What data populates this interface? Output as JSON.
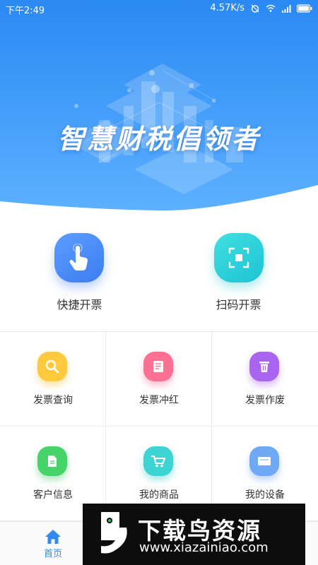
{
  "status_bar": {
    "time": "下午2:49",
    "speed": "4.57K/s",
    "icons": [
      "alarm-icon",
      "wifi-icon",
      "signal-icon",
      "battery-icon"
    ]
  },
  "hero": {
    "slogan": "智慧财税倡领者",
    "gradient_top": "#2f8ef5",
    "gradient_bottom": "#4aa6ff"
  },
  "primary_actions": [
    {
      "label": "快捷开票",
      "icon": "tap-hand-icon",
      "color": "#4a8af4"
    },
    {
      "label": "扫码开票",
      "icon": "scan-icon",
      "color": "#27ccd8"
    }
  ],
  "grid": [
    {
      "label": "发票查询",
      "icon": "search-icon",
      "color": "#ffc93d"
    },
    {
      "label": "发票冲红",
      "icon": "document-icon",
      "color": "#ff6f92"
    },
    {
      "label": "发票作废",
      "icon": "trash-icon",
      "color": "#a964f0"
    },
    {
      "label": "客户信息",
      "icon": "file-icon",
      "color": "#46d36a"
    },
    {
      "label": "我的商品",
      "icon": "cart-icon",
      "color": "#3fd4d4"
    },
    {
      "label": "我的设备",
      "icon": "device-icon",
      "color": "#6fa8f5"
    }
  ],
  "bottom_nav": {
    "home_label": "首页",
    "active_color": "#2f8bf0"
  },
  "watermark": {
    "brand": "下载鸟资源",
    "url": "www.xiazainiao.com"
  }
}
